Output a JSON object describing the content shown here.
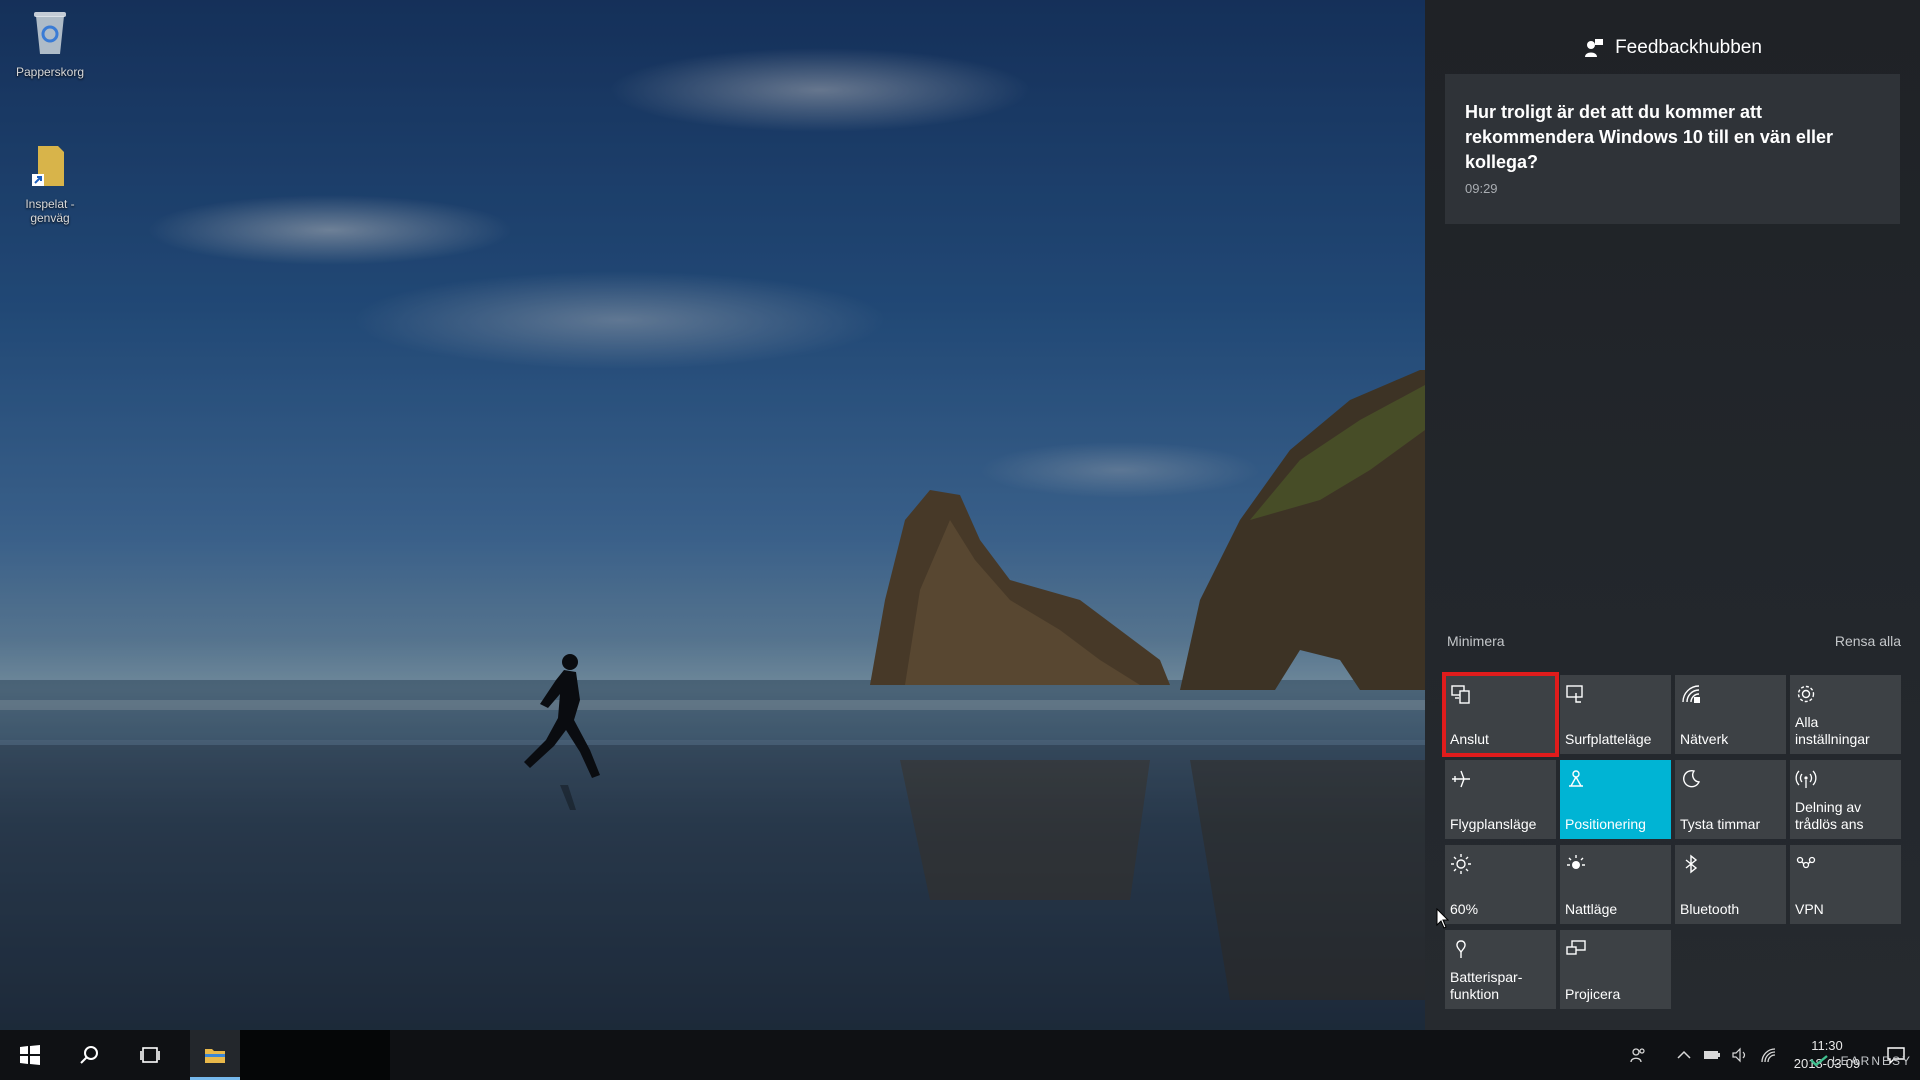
{
  "desktop": {
    "icons": [
      {
        "label": "Papperskorg",
        "icon": "recycle-bin-icon"
      },
      {
        "label": "Inspelat -\ngenväg",
        "icon": "folder-shortcut-icon"
      }
    ]
  },
  "action_center": {
    "header": {
      "title": "Feedbackhubben",
      "icon": "feedback-hub-icon"
    },
    "notification": {
      "text": "Hur troligt är det att du kommer att rekommendera Windows 10 till en vän eller kollega?",
      "time": "09:29"
    },
    "collapse_label": "Minimera",
    "clear_all_label": "Rensa alla",
    "tiles": [
      {
        "label": "Anslut",
        "icon": "connect-icon",
        "active": false,
        "selected": true
      },
      {
        "label": "Surfplatteläge",
        "icon": "tablet-mode-icon",
        "active": false
      },
      {
        "label": "Nätverk",
        "icon": "network-icon",
        "active": false
      },
      {
        "label": "Alla\ninställningar",
        "icon": "settings-gear-icon",
        "active": false
      },
      {
        "label": "Flygplansläge",
        "icon": "airplane-icon",
        "active": false
      },
      {
        "label": "Positionering",
        "icon": "location-icon",
        "active": true
      },
      {
        "label": "Tysta timmar",
        "icon": "moon-icon",
        "active": false
      },
      {
        "label": "Delning av\ntrådlös ans",
        "icon": "hotspot-icon",
        "active": false
      },
      {
        "label": "60%",
        "icon": "brightness-icon",
        "active": false
      },
      {
        "label": "Nattläge",
        "icon": "night-light-icon",
        "active": false
      },
      {
        "label": "Bluetooth",
        "icon": "bluetooth-icon",
        "active": false
      },
      {
        "label": "VPN",
        "icon": "vpn-icon",
        "active": false
      },
      {
        "label": "Batterispar-\nfunktion",
        "icon": "battery-saver-icon",
        "active": false
      },
      {
        "label": "Projicera",
        "icon": "project-icon",
        "active": false
      }
    ]
  },
  "taskbar": {
    "clock_time": "11:30",
    "clock_date": "2018-03-09",
    "watermark": "LEARNESY"
  },
  "colors": {
    "accent": "#00b4d4",
    "highlight": "#e01c1c",
    "taskbar": "#0f1114"
  }
}
